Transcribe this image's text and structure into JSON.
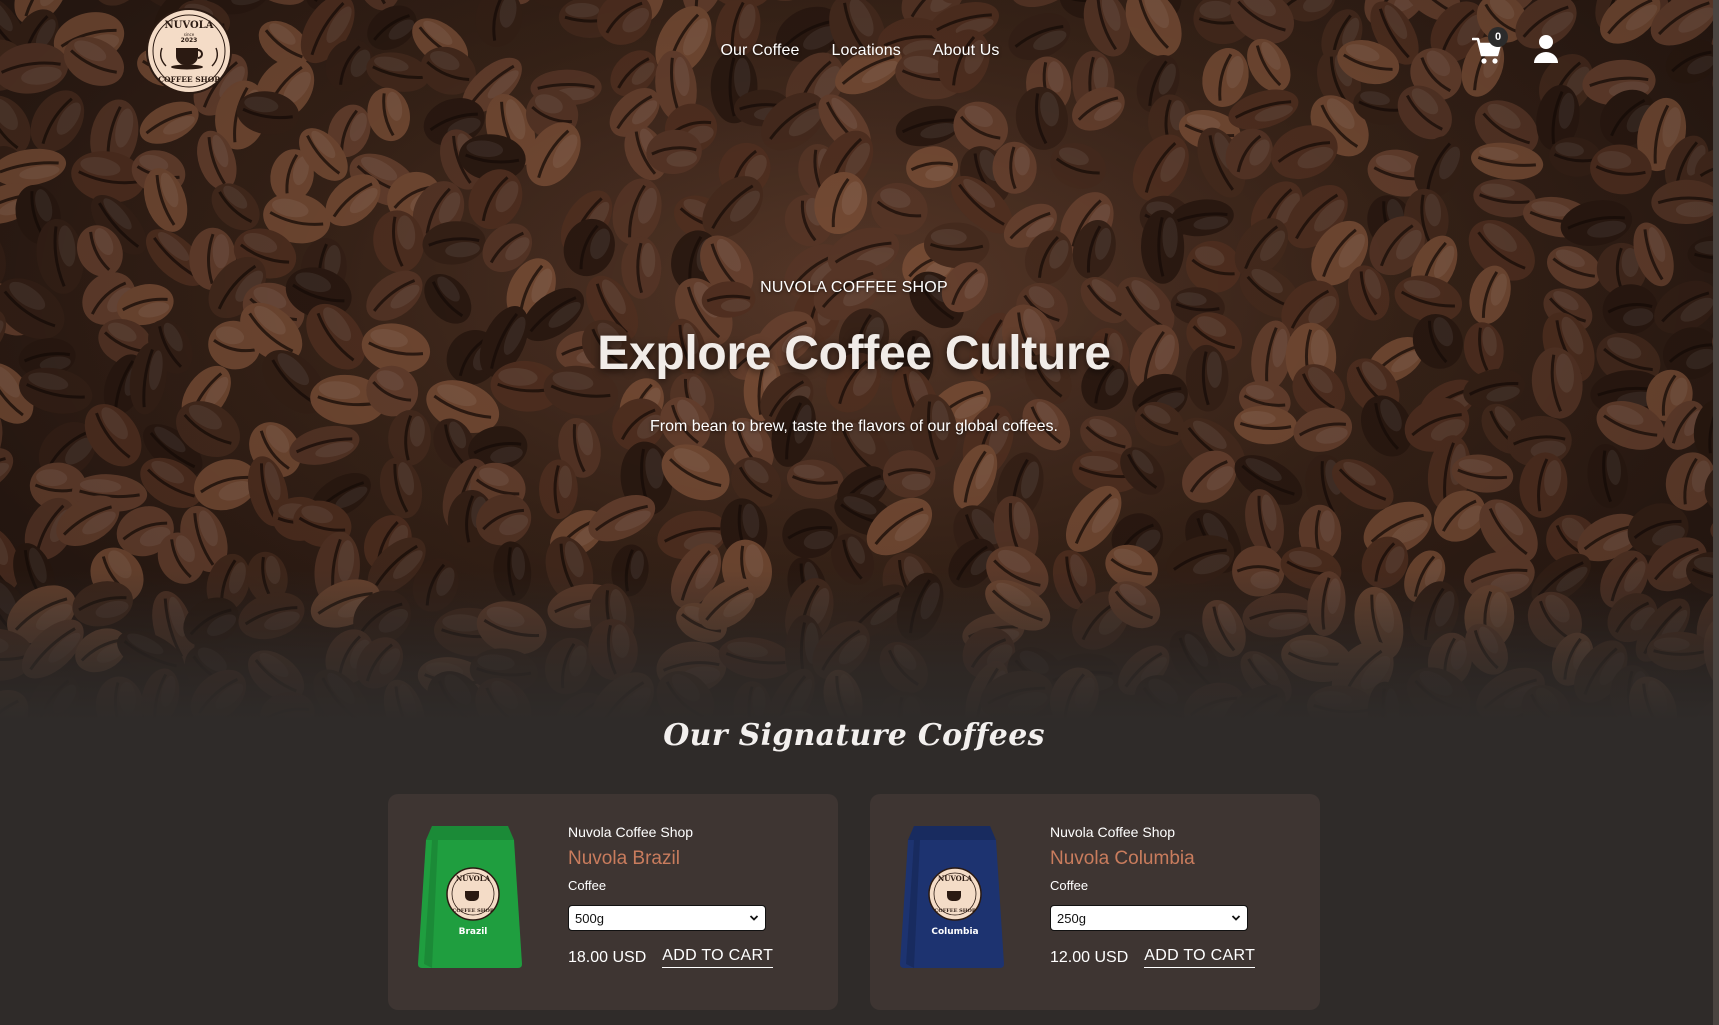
{
  "brand": {
    "logo_top": "NUVOLA",
    "logo_since": "since",
    "logo_year": "2023",
    "logo_bottom": "COFFEE SHOP"
  },
  "nav": {
    "items": [
      {
        "label": "Our Coffee"
      },
      {
        "label": "Locations"
      },
      {
        "label": "About Us"
      }
    ]
  },
  "cart": {
    "count": "0",
    "icon": "cart-icon"
  },
  "user": {
    "icon": "user-icon"
  },
  "hero": {
    "eyebrow": "NUVOLA COFFEE SHOP",
    "headline": "Explore Coffee Culture",
    "subline": "From bean to brew, taste the flavors of our global coffees."
  },
  "section": {
    "title": "Our Signature Coffees"
  },
  "products": [
    {
      "brand": "Nuvola Coffee Shop",
      "name": "Nuvola Brazil",
      "type": "Coffee",
      "size": "500g",
      "price": "18.00 USD",
      "add_label": "ADD TO CART",
      "bag_label": "Brazil",
      "bag_color": "#1f9e3f"
    },
    {
      "brand": "Nuvola Coffee Shop",
      "name": "Nuvola Columbia",
      "type": "Coffee",
      "size": "250g",
      "price": "12.00 USD",
      "add_label": "ADD TO CART",
      "bag_label": "Columbia",
      "bag_color": "#1d3370"
    }
  ],
  "colors": {
    "accent": "#c97c5d",
    "page_bg": "#2f2b29",
    "card_bg": "#3e3532"
  }
}
